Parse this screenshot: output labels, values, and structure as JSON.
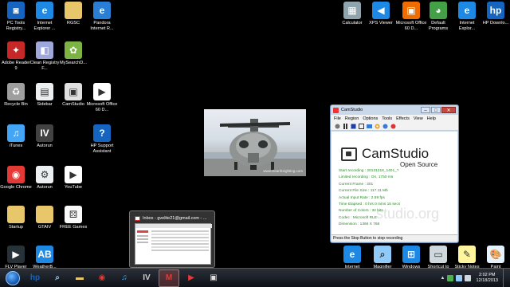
{
  "desktop_icons_left": [
    {
      "label": "PC Tools Registry...",
      "icon": "pc-tools-icon",
      "color": "#1565c0",
      "glyph": "◙"
    },
    {
      "label": "Internet Explorer ...",
      "icon": "internet-explorer-icon",
      "color": "#1e88e5",
      "glyph": "e"
    },
    {
      "label": "RGSC",
      "icon": "folder-icon",
      "color": "#e8c76a",
      "glyph": ""
    },
    {
      "label": "Pandora Internet R...",
      "icon": "pandora-icon",
      "color": "#2a7fd4",
      "glyph": "e"
    },
    {
      "label": "Adobe Reader 9",
      "icon": "adobe-reader-icon",
      "color": "#c62828",
      "glyph": "✦"
    },
    {
      "label": "Clean Registry F...",
      "icon": "clean-registry-icon",
      "color": "#9fa8da",
      "glyph": "◧"
    },
    {
      "label": "MySearchD...",
      "icon": "mysearch-icon",
      "color": "#7cb342",
      "glyph": "✿"
    },
    {
      "label": "Recycle Bin",
      "icon": "recycle-bin-icon",
      "color": "#9e9e9e",
      "glyph": "♻"
    },
    {
      "label": "Sidebar",
      "icon": "sidebar-icon",
      "color": "#eceff1",
      "glyph": "▤"
    },
    {
      "label": "CamStudio",
      "icon": "camstudio-icon",
      "color": "#e0e0e0",
      "glyph": "▣"
    },
    {
      "label": "Microsoft Office 60 D...",
      "icon": "office-trial-icon",
      "color": "#ffffff",
      "glyph": "▶"
    },
    {
      "label": "iTunes",
      "icon": "itunes-icon",
      "color": "#42a5f5",
      "glyph": "♫"
    },
    {
      "label": "Autorun",
      "icon": "autorun-icon",
      "color": "#424242",
      "glyph": "IV"
    },
    {
      "label": "HP Support Assistant",
      "icon": "hp-support-icon",
      "color": "#1565c0",
      "glyph": "?"
    },
    {
      "label": "Google Chrome",
      "icon": "chrome-icon",
      "color": "#e53935",
      "glyph": "◉"
    },
    {
      "label": "Autorun",
      "icon": "autorun-file-icon",
      "color": "#eceff1",
      "glyph": "⚙"
    },
    {
      "label": "YouTube",
      "icon": "youtube-icon",
      "color": "#ffffff",
      "glyph": "▶"
    },
    {
      "label": "Startup",
      "icon": "folder-icon",
      "color": "#e8c76a",
      "glyph": ""
    },
    {
      "label": "GTAIV",
      "icon": "folder-icon",
      "color": "#e8c76a",
      "glyph": ""
    },
    {
      "label": "FREE Games",
      "icon": "dice-icon",
      "color": "#fafafa",
      "glyph": "⚄"
    },
    {
      "label": "FLV Player",
      "icon": "flv-player-icon",
      "color": "#263238",
      "glyph": "▶"
    },
    {
      "label": "WeatherB...",
      "icon": "weatherbug-icon",
      "color": "#1e88e5",
      "glyph": "AB"
    }
  ],
  "desktop_icons_right": [
    {
      "label": "Calculator",
      "icon": "calculator-icon",
      "color": "#90a4ae",
      "glyph": "▦"
    },
    {
      "label": "XPS Viewer",
      "icon": "xps-viewer-icon",
      "color": "#1e88e5",
      "glyph": "◀"
    },
    {
      "label": "Microsoft Office 60 D...",
      "icon": "office-icon",
      "color": "#ef6c00",
      "glyph": "▣"
    },
    {
      "label": "Default Programs",
      "icon": "default-programs-icon",
      "color": "#43a047",
      "glyph": "◕"
    },
    {
      "label": "Internet Explor...",
      "icon": "internet-explorer-icon",
      "color": "#1e88e5",
      "glyph": "e"
    },
    {
      "label": "HP Downlo...",
      "icon": "hp-download-icon",
      "color": "#1565c0",
      "glyph": "hp"
    },
    {
      "label": "Internet",
      "icon": "internet-icon",
      "color": "#1e88e5",
      "glyph": "e"
    },
    {
      "label": "Magnifier",
      "icon": "magnifier-icon",
      "color": "#90caf9",
      "glyph": "⌕"
    },
    {
      "label": "Windows",
      "icon": "windows-icon",
      "color": "#1e88e5",
      "glyph": "⊞"
    },
    {
      "label": "Shortcut to",
      "icon": "shortcut-icon",
      "color": "#cfd8dc",
      "glyph": "▭"
    },
    {
      "label": "Sticky Notes",
      "icon": "sticky-notes-icon",
      "color": "#fff59d",
      "glyph": "✎"
    },
    {
      "label": "Paint",
      "icon": "paint-icon",
      "color": "#e3f2fd",
      "glyph": "🎨"
    }
  ],
  "photo": {
    "caption": "www.cleanfreighting.com"
  },
  "taskbar_preview": {
    "title": "Inbox - gvelite21@gmail.com - ..."
  },
  "camstudio": {
    "title": "CamStudio",
    "menu": [
      "File",
      "Region",
      "Options",
      "Tools",
      "Effects",
      "View",
      "Help"
    ],
    "brand": "CamStudio",
    "brand_sub": "Open Source",
    "watermark": "studio.org",
    "stats": [
      "Start recording : 20131218_1401_?",
      "Limited recording : On, 1750 ms",
      "Current Frame : 301",
      "Current File Size : 117.11 Mb",
      "Actual Input Rate : 2.59 fps",
      "Time Elapsed : 0 hrs 0 mins 15 secs",
      "Number of Colors : 32 bits",
      "Codec : Microsoft RLE",
      "Dimension : 1366 X 768"
    ],
    "status": "Press the Stop Button to stop recording"
  },
  "taskbar": {
    "buttons": [
      {
        "name": "hp-taskbar-icon",
        "glyph": "hp",
        "color": "#1565c0"
      },
      {
        "name": "magnifier-taskbar-icon",
        "glyph": "⌕",
        "color": "#90caf9"
      },
      {
        "name": "explorer-taskbar-icon",
        "glyph": "▬",
        "color": "#e8c76a"
      },
      {
        "name": "chrome-taskbar-icon",
        "glyph": "◉",
        "color": "#e53935"
      },
      {
        "name": "itunes-taskbar-icon",
        "glyph": "♫",
        "color": "#42a5f5"
      },
      {
        "name": "gta-taskbar-icon",
        "glyph": "IV",
        "color": "#cfcfcf"
      },
      {
        "name": "gmail-taskbar-icon",
        "glyph": "M",
        "color": "#e53935"
      },
      {
        "name": "youtube-taskbar-icon",
        "glyph": "▶",
        "color": "#e53935"
      },
      {
        "name": "camstudio-taskbar-icon",
        "glyph": "▣",
        "color": "#e0e0e0"
      }
    ],
    "clock_time": "2:02 PM",
    "clock_date": "12/18/2013"
  }
}
